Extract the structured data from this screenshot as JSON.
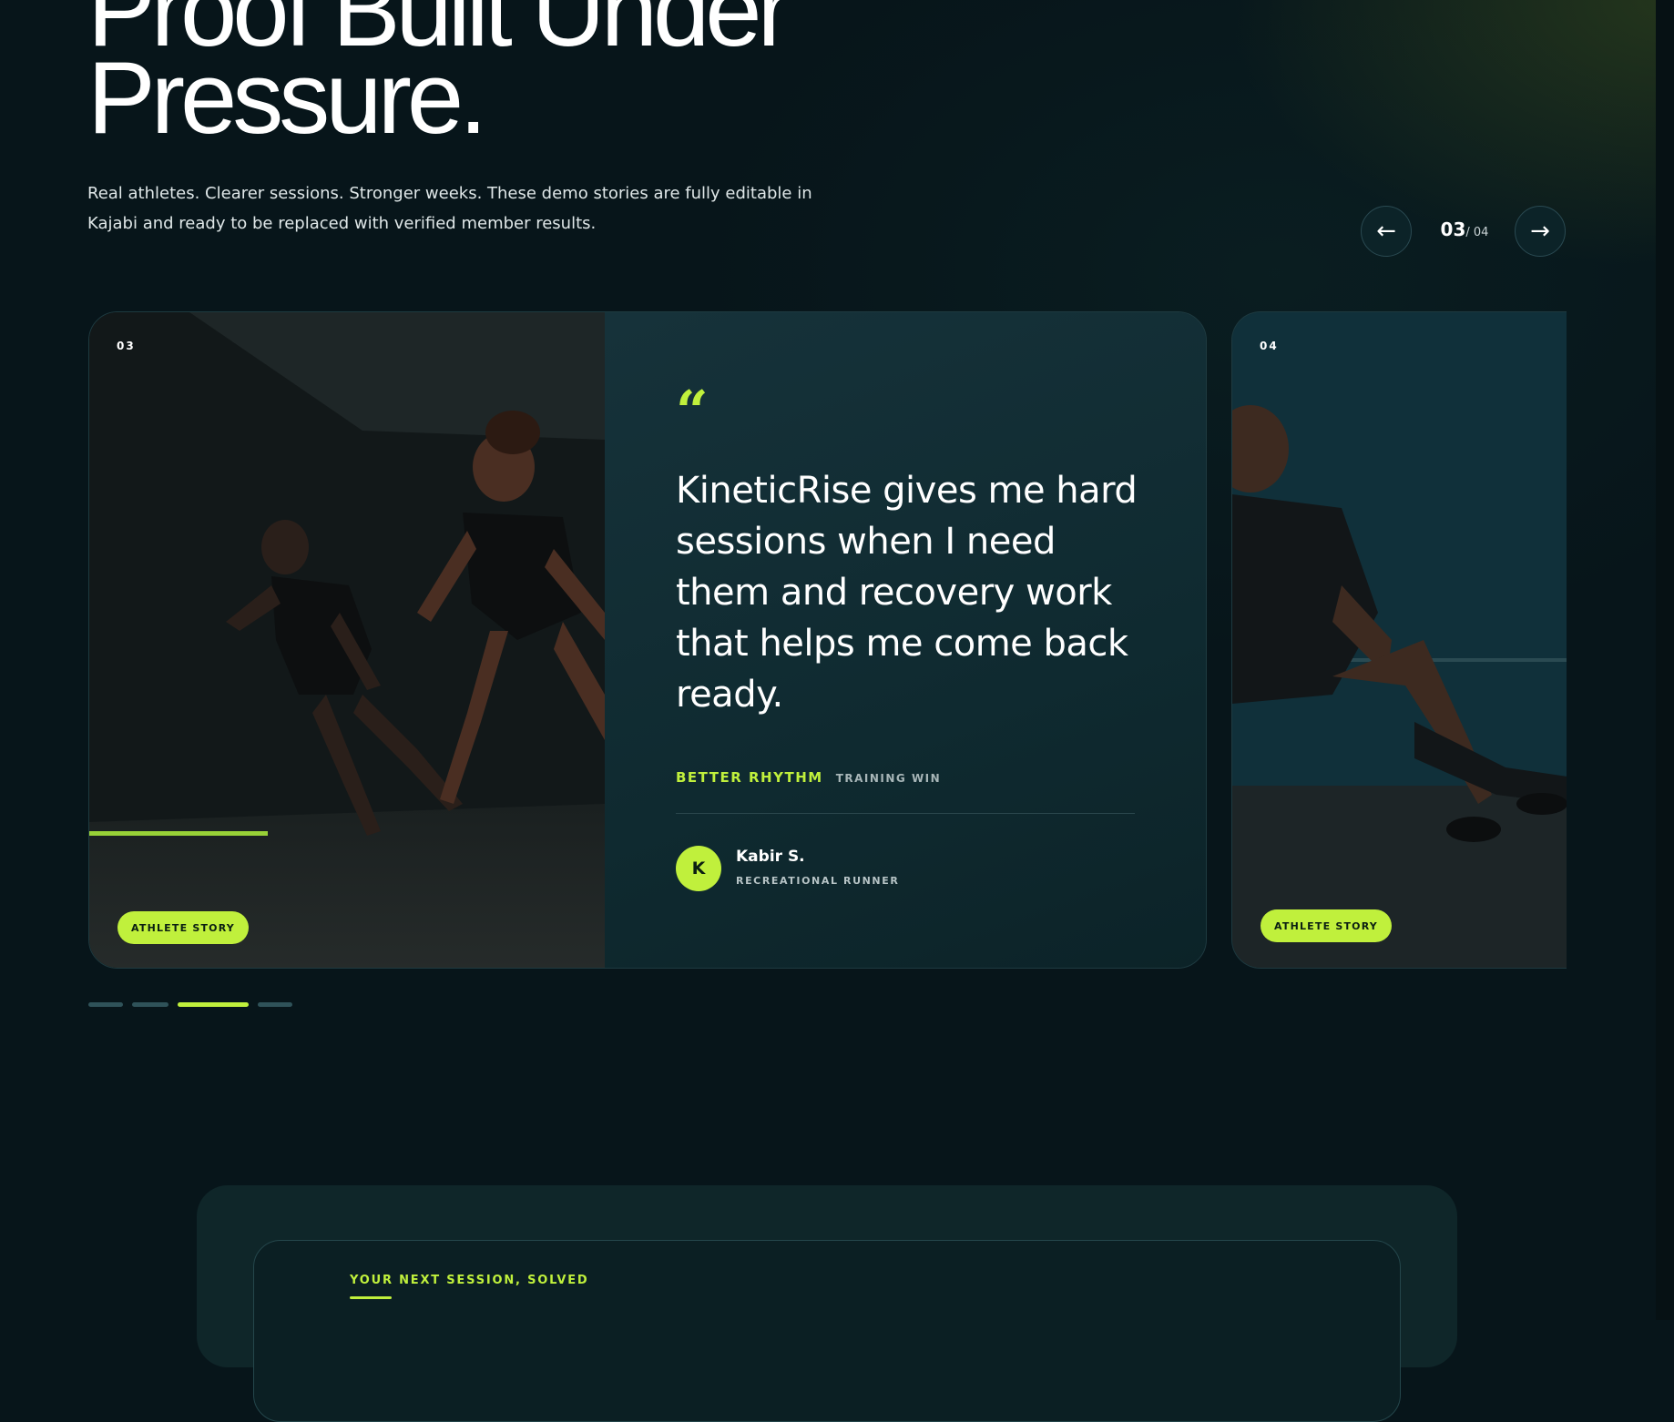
{
  "hero": {
    "title": "Proof Built Under Pressure.",
    "subtitle": "Real athletes. Clearer sessions. Stronger weeks. These demo stories are fully editable in Kajabi and ready to be replaced with verified member results."
  },
  "carousel": {
    "current": "03",
    "total": "/ 04",
    "prev_icon": "arrow-left-icon",
    "next_icon": "arrow-right-icon",
    "prev_glyph": "←",
    "next_glyph": "→",
    "slides": [
      {
        "number": "03",
        "badge": "ATHLETE STORY",
        "quote_mark": "“",
        "quote": "KineticRise gives me hard sessions when I need them and recovery work that helps me come back ready.",
        "tag_primary": "BETTER RHYTHM",
        "tag_secondary": "TRAINING WIN",
        "avatar_initial": "K",
        "author_name": "Kabir S.",
        "author_role": "RECREATIONAL RUNNER"
      },
      {
        "number": "04",
        "badge": "ATHLETE STORY"
      }
    ],
    "active_dot_index": 2
  },
  "cta": {
    "eyebrow": "YOUR NEXT SESSION, SOLVED"
  },
  "colors": {
    "background": "#07151a",
    "accent": "#c0f03c",
    "card": "#10292f"
  }
}
